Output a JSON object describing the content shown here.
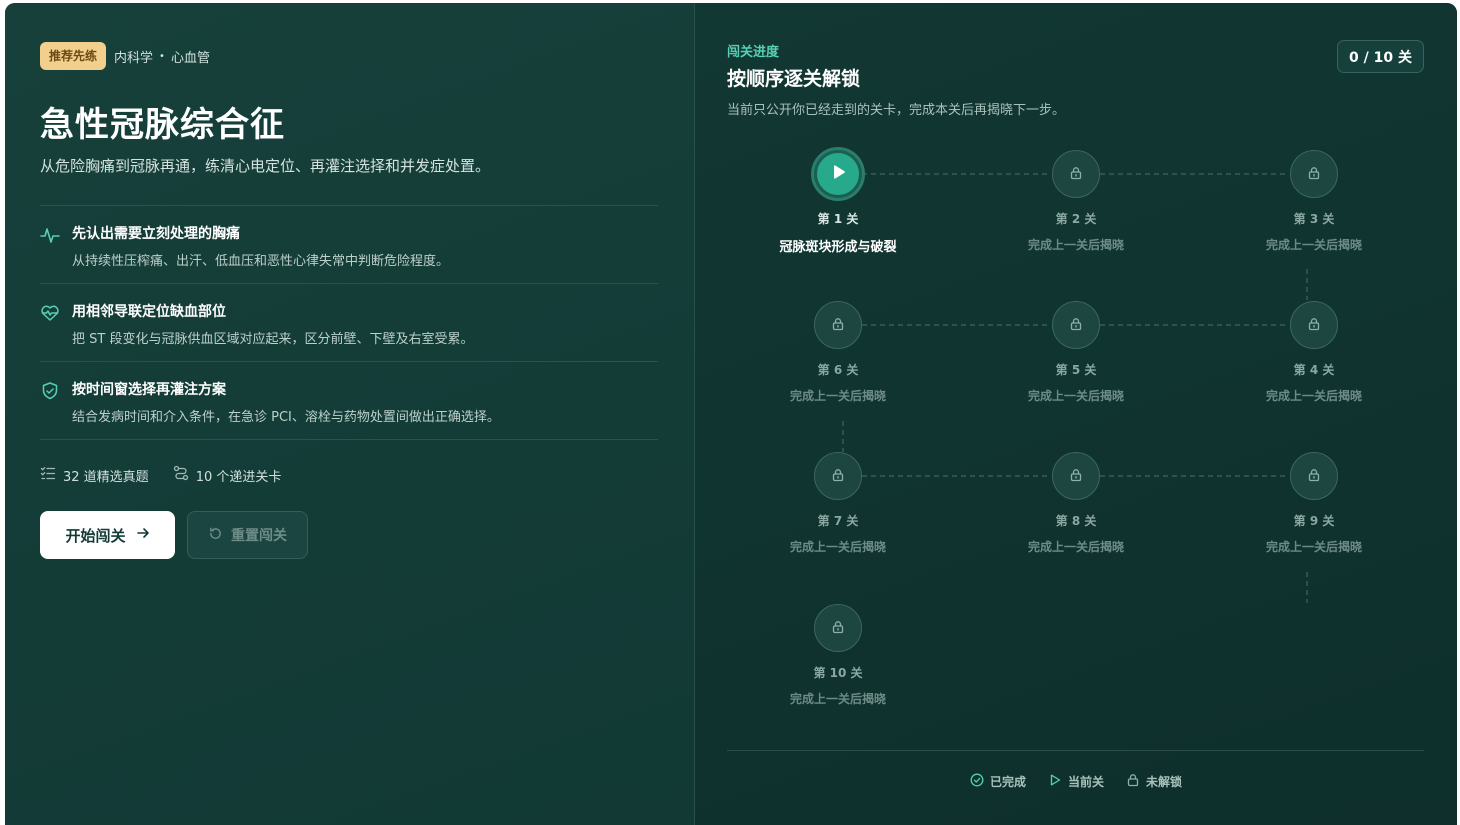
{
  "course": {
    "badge": "推荐先练",
    "department": "内科学",
    "separator": "•",
    "specialty": "心血管",
    "title": "急性冠脉综合征",
    "subtitle": "从危险胸痛到冠脉再通，练清心电定位、再灌注选择和并发症处置。"
  },
  "features": [
    {
      "icon": "pulse-icon",
      "title": "先认出需要立刻处理的胸痛",
      "desc": "从持续性压榨痛、出汗、低血压和恶性心律失常中判断危险程度。"
    },
    {
      "icon": "heart-pulse-icon",
      "title": "用相邻导联定位缺血部位",
      "desc": "把 ST 段变化与冠脉供血区域对应起来，区分前壁、下壁及右室受累。"
    },
    {
      "icon": "shield-check-icon",
      "title": "按时间窗选择再灌注方案",
      "desc": "结合发病时间和介入条件，在急诊 PCI、溶栓与药物处置间做出正确选择。"
    }
  ],
  "stats": {
    "questions": "32 道精选真题",
    "levels": "10 个递进关卡"
  },
  "buttons": {
    "start": "开始闯关",
    "reset": "重置闯关"
  },
  "progress": {
    "eyebrow": "闯关进度",
    "title": "按顺序逐关解锁",
    "desc": "当前只公开你已经走到的关卡，完成本关后再揭晓下一步。",
    "counter": "0 / 10 关",
    "completed": 0,
    "total": 10
  },
  "levels": [
    {
      "label": "第 1 关",
      "name": "冠脉斑块形成与破裂",
      "state": "current"
    },
    {
      "label": "第 2 关",
      "name": "完成上一关后揭晓",
      "state": "locked"
    },
    {
      "label": "第 3 关",
      "name": "完成上一关后揭晓",
      "state": "locked"
    },
    {
      "label": "第 4 关",
      "name": "完成上一关后揭晓",
      "state": "locked"
    },
    {
      "label": "第 5 关",
      "name": "完成上一关后揭晓",
      "state": "locked"
    },
    {
      "label": "第 6 关",
      "name": "完成上一关后揭晓",
      "state": "locked"
    },
    {
      "label": "第 7 关",
      "name": "完成上一关后揭晓",
      "state": "locked"
    },
    {
      "label": "第 8 关",
      "name": "完成上一关后揭晓",
      "state": "locked"
    },
    {
      "label": "第 9 关",
      "name": "完成上一关后揭晓",
      "state": "locked"
    },
    {
      "label": "第 10 关",
      "name": "完成上一关后揭晓",
      "state": "locked"
    }
  ],
  "legend": {
    "done": "已完成",
    "current": "当前关",
    "locked": "未解锁"
  },
  "colors": {
    "accent": "#56d0b4",
    "current_node": "#27a98c",
    "badge": "#f3cf8e",
    "panel": "#123a36"
  }
}
